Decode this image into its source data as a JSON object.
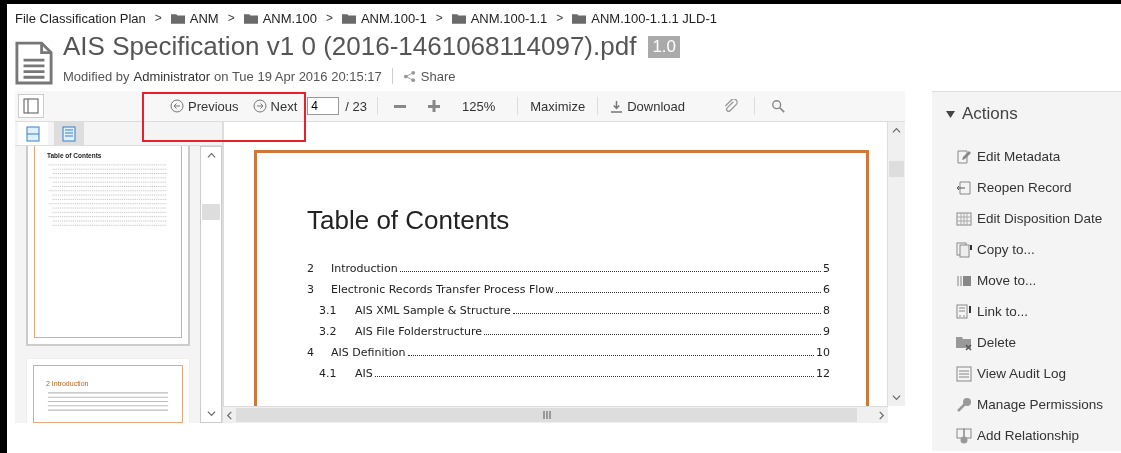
{
  "breadcrumb": [
    {
      "label": "File Classification Plan",
      "kind": "root"
    },
    {
      "label": "ANM",
      "kind": "folder"
    },
    {
      "label": "ANM.100",
      "kind": "folder"
    },
    {
      "label": "ANM.100-1",
      "kind": "folder"
    },
    {
      "label": "ANM.100-1.1",
      "kind": "folder"
    },
    {
      "label": "ANM.100-1.1.1 JLD-1",
      "kind": "folder"
    }
  ],
  "separator": ">",
  "document": {
    "title": "AIS Specification v1 0 (2016-1461068114097).pdf",
    "version": "1.0",
    "modified_prefix": "Modified by",
    "modified_by": "Administrator",
    "modified_suffix": "on Tue 19 Apr 2016 20:15:17",
    "share": "Share"
  },
  "toolbar": {
    "previous": "Previous",
    "next": "Next",
    "page": "4",
    "page_total": "/ 23",
    "zoom": "125%",
    "maximize": "Maximize",
    "download": "Download"
  },
  "thumbnail_tabs": [
    {
      "kind": "pages",
      "selected": true
    },
    {
      "kind": "outline",
      "selected": false
    }
  ],
  "thumbnails": [
    {
      "title": "Table of Contents",
      "kind": "toc",
      "selected": true
    },
    {
      "title": "2 Introduction",
      "kind": "text",
      "selected": false
    }
  ],
  "page": {
    "heading": "Table of Contents",
    "toc": [
      {
        "number": "2",
        "title": "Introduction",
        "page": "5"
      },
      {
        "number": "3",
        "title": "Electronic Records Transfer Process Flow",
        "page": "6",
        "children": [
          {
            "number": "3.1",
            "title": "AIS XML Sample & Structure",
            "page": "8"
          },
          {
            "number": "3.2",
            "title": "AIS File Folderstructure",
            "page": "9"
          }
        ]
      },
      {
        "number": "4",
        "title": "AIS Definition",
        "page": "10",
        "children": [
          {
            "number": "4.1",
            "title": "AIS",
            "page": "12"
          }
        ]
      }
    ]
  },
  "actions": {
    "title": "Actions",
    "expanded": true,
    "items": [
      {
        "label": "Edit Metadata",
        "kind": "edit"
      },
      {
        "label": "Reopen Record",
        "kind": "reopen"
      },
      {
        "label": "Edit Disposition Date",
        "kind": "calendar"
      },
      {
        "label": "Copy to...",
        "kind": "copy"
      },
      {
        "label": "Move to...",
        "kind": "move"
      },
      {
        "label": "Link to...",
        "kind": "link"
      },
      {
        "label": "Delete",
        "kind": "delete"
      },
      {
        "label": "View Audit Log",
        "kind": "log"
      },
      {
        "label": "Manage Permissions",
        "kind": "key"
      },
      {
        "label": "Add Relationship",
        "kind": "relation"
      }
    ]
  }
}
